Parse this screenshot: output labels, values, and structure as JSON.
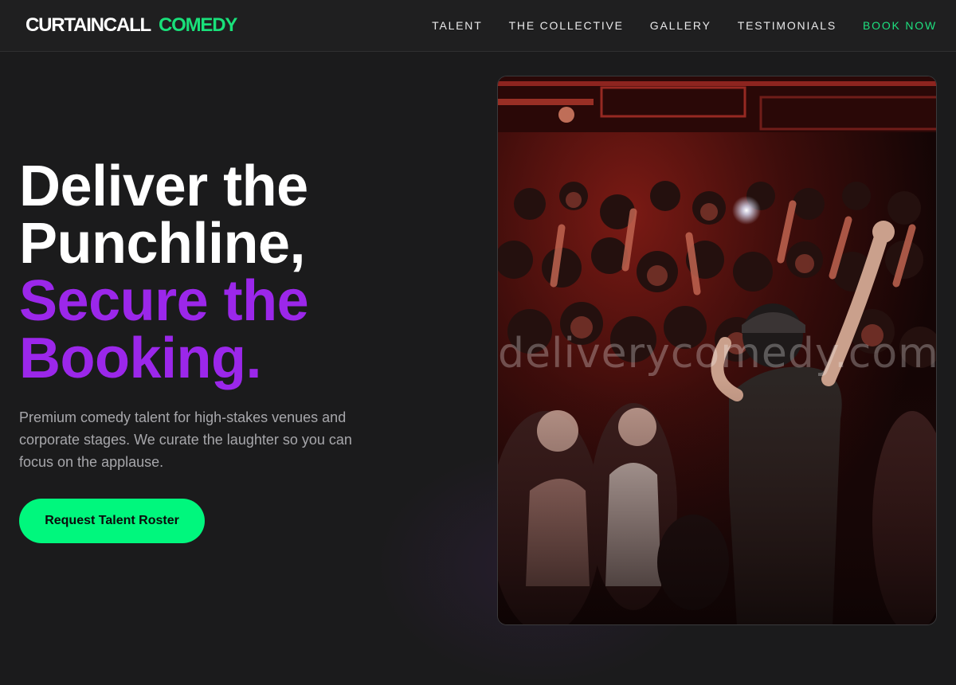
{
  "brand": {
    "name_primary": "CURTAINCALL",
    "name_accent": "COMEDY"
  },
  "nav": {
    "items": [
      {
        "label": "TALENT"
      },
      {
        "label": "THE COLLECTIVE"
      },
      {
        "label": "GALLERY"
      },
      {
        "label": "TESTIMONIALS"
      },
      {
        "label": "BOOK NOW"
      }
    ]
  },
  "hero": {
    "headline_line1": "Deliver the",
    "headline_line2": "Punchline,",
    "headline_line3": "Secure the",
    "headline_line4": "Booking.",
    "subtitle": "Premium comedy talent for high-stakes venues and corporate stages. We curate the laughter so you can focus on the applause.",
    "cta_label": "Request Talent Roster"
  },
  "image": {
    "description_icon": "crowd-performer-photo",
    "watermark": "deliverycomedy.com"
  },
  "colors": {
    "background": "#1b1b1c",
    "accent_green": "#00f77d",
    "accent_purple": "#9b27ea",
    "nav_accent": "#1ee07f"
  }
}
